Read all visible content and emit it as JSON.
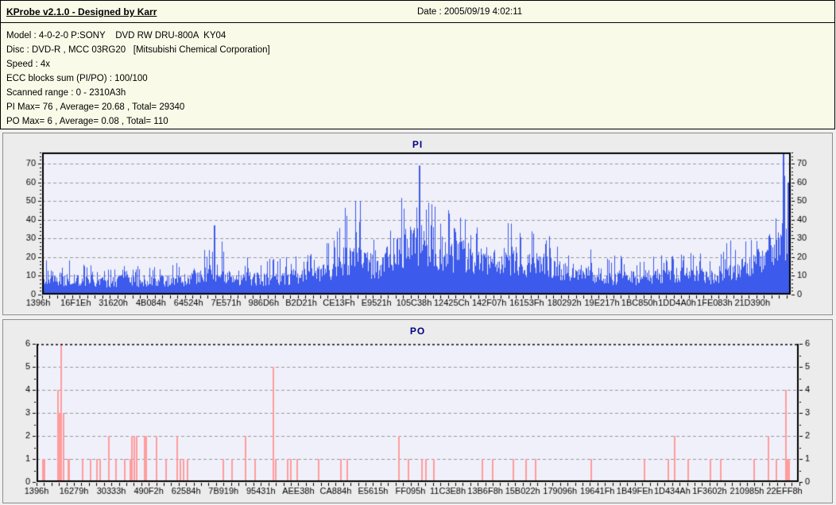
{
  "header": {
    "app_title": "KProbe v2.1.0 - Designed by Karr",
    "date_label": "Date : 2005/09/19 4:02:11",
    "info_lines": [
      "Model : 4-0-2-0 P:SONY    DVD RW DRU-800A  KY04",
      "Disc : DVD-R , MCC 03RG20   [Mitsubishi Chemical Corporation]",
      "Speed : 4x",
      "ECC blocks sum (PI/PO) : 100/100",
      "Scanned range : 0 - 2310A3h",
      "PI Max= 76 , Average= 20.68 , Total= 29340",
      "PO Max= 6 , Average= 0.08 , Total= 110"
    ]
  },
  "theme": {
    "header_bg": "#FAFAE8",
    "panel_bg": "#ECECEC",
    "grid_color": "#999999",
    "axis_color": "#000000"
  },
  "chart_data": [
    {
      "id": "pi",
      "type": "bar",
      "title": "PI",
      "title_color": "#000080",
      "bar_color": "#3C5AEB",
      "plot_bg": "#F0F0FA",
      "grid": true,
      "legend": "none",
      "ylim": [
        0,
        76
      ],
      "yticks": [
        0,
        10,
        20,
        30,
        40,
        50,
        60,
        70
      ],
      "yminor_step": 2,
      "stats": {
        "max": 76,
        "average": 20.68,
        "total": 29340
      },
      "x_labels": [
        "1396h",
        "16F1Eh",
        "31620h",
        "4B084h",
        "64524h",
        "7E571h",
        "986D6h",
        "B2D21h",
        "CE13Fh",
        "E9521h",
        "105C38h",
        "12425Ch",
        "142F07h",
        "16153Fh",
        "180292h",
        "19E217h",
        "1BC850h",
        "1DD4A0h",
        "1FE083h",
        "21D390h"
      ],
      "envelope_typical": [
        12,
        10,
        9,
        9,
        8,
        9,
        9,
        9,
        9,
        10,
        13,
        14,
        11,
        10,
        10,
        10,
        12,
        13,
        14,
        22,
        24,
        16,
        26,
        32,
        34,
        28,
        25,
        24,
        22,
        22,
        21,
        19,
        18,
        15,
        13,
        12,
        11,
        11,
        11,
        12,
        12,
        13,
        12,
        14,
        17,
        22,
        30,
        40
      ],
      "envelope_peak": [
        22,
        20,
        18,
        17,
        16,
        17,
        16,
        17,
        18,
        20,
        28,
        35,
        24,
        20,
        26,
        20,
        24,
        26,
        28,
        50,
        52,
        35,
        52,
        60,
        69,
        55,
        48,
        45,
        44,
        46,
        42,
        38,
        36,
        28,
        26,
        24,
        22,
        22,
        23,
        24,
        25,
        27,
        24,
        28,
        32,
        42,
        52,
        76
      ],
      "notable_spikes": [
        [
          0.229,
          37
        ],
        [
          0.503,
          69
        ],
        [
          0.989,
          76
        ],
        [
          0.996,
          60
        ]
      ]
    },
    {
      "id": "po",
      "type": "bar",
      "title": "PO",
      "title_color": "#000080",
      "bar_color": "#FF9C9C",
      "plot_bg": "#F0F0FA",
      "grid": true,
      "legend": "none",
      "ylim": [
        0,
        6
      ],
      "yticks": [
        0,
        1,
        2,
        3,
        4,
        5,
        6
      ],
      "yminor_step": 0.5,
      "stats": {
        "max": 6,
        "average": 0.08,
        "total": 110
      },
      "x_labels": [
        "1396h",
        "16279h",
        "30333h",
        "490F2h",
        "62584h",
        "7B919h",
        "95431h",
        "AEE38h",
        "CA884h",
        "E5615h",
        "FF095h",
        "11C3E8h",
        "13B6F8h",
        "15B022h",
        "179096h",
        "19641Fh",
        "1B49FEh",
        "1D434Ah",
        "1F3602h",
        "210985h",
        "22EFF8h"
      ],
      "events": [
        [
          0.007,
          1
        ],
        [
          0.009,
          1
        ],
        [
          0.027,
          4
        ],
        [
          0.029,
          3
        ],
        [
          0.031,
          6
        ],
        [
          0.034,
          3
        ],
        [
          0.041,
          1
        ],
        [
          0.042,
          1
        ],
        [
          0.059,
          1
        ],
        [
          0.07,
          1
        ],
        [
          0.078,
          1
        ],
        [
          0.082,
          1
        ],
        [
          0.094,
          2
        ],
        [
          0.103,
          1
        ],
        [
          0.115,
          1
        ],
        [
          0.122,
          1
        ],
        [
          0.124,
          2
        ],
        [
          0.127,
          2
        ],
        [
          0.13,
          2
        ],
        [
          0.141,
          2
        ],
        [
          0.143,
          2
        ],
        [
          0.156,
          2
        ],
        [
          0.169,
          1
        ],
        [
          0.184,
          2
        ],
        [
          0.188,
          1
        ],
        [
          0.192,
          1
        ],
        [
          0.197,
          1
        ],
        [
          0.244,
          1
        ],
        [
          0.255,
          1
        ],
        [
          0.273,
          2
        ],
        [
          0.286,
          1
        ],
        [
          0.31,
          5
        ],
        [
          0.313,
          1
        ],
        [
          0.328,
          1
        ],
        [
          0.333,
          1
        ],
        [
          0.341,
          1
        ],
        [
          0.369,
          1
        ],
        [
          0.398,
          1
        ],
        [
          0.407,
          1
        ],
        [
          0.474,
          2
        ],
        [
          0.487,
          1
        ],
        [
          0.505,
          1
        ],
        [
          0.51,
          1
        ],
        [
          0.52,
          1
        ],
        [
          0.584,
          1
        ],
        [
          0.597,
          1
        ],
        [
          0.625,
          1
        ],
        [
          0.641,
          1
        ],
        [
          0.654,
          1
        ],
        [
          0.727,
          1
        ],
        [
          0.797,
          1
        ],
        [
          0.828,
          1
        ],
        [
          0.836,
          2
        ],
        [
          0.854,
          1
        ],
        [
          0.883,
          1
        ],
        [
          0.897,
          1
        ],
        [
          0.941,
          1
        ],
        [
          0.959,
          2
        ],
        [
          0.97,
          1
        ],
        [
          0.982,
          4
        ],
        [
          0.984,
          1
        ],
        [
          0.986,
          1
        ],
        [
          0.998,
          2
        ]
      ]
    }
  ]
}
